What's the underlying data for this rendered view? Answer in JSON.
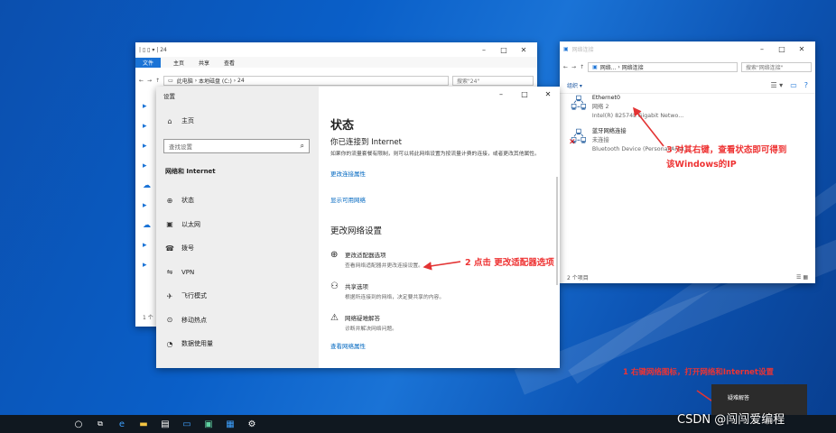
{
  "explorer": {
    "qat": "| ▯ ▯ ▾ | 24",
    "ribbon_tabs": [
      "文件",
      "主页",
      "共享",
      "查看"
    ],
    "address_path": [
      "此电脑",
      "本地磁盘 (C:)",
      "24"
    ],
    "search_placeholder": "搜索\"24\"",
    "status": "1 个"
  },
  "settings": {
    "title": "设置",
    "home": "主页",
    "search_placeholder": "查找设置",
    "section": "网络和 Internet",
    "nav": [
      {
        "icon": "status-icon",
        "glyph": "⊕",
        "label": "状态"
      },
      {
        "icon": "ethernet-icon",
        "glyph": "▣",
        "label": "以太网"
      },
      {
        "icon": "dialup-icon",
        "glyph": "☎",
        "label": "拨号"
      },
      {
        "icon": "vpn-icon",
        "glyph": "⇋",
        "label": "VPN"
      },
      {
        "icon": "airplane-icon",
        "glyph": "✈",
        "label": "飞行模式"
      },
      {
        "icon": "hotspot-icon",
        "glyph": "⊙",
        "label": "移动热点"
      },
      {
        "icon": "data-usage-icon",
        "glyph": "◔",
        "label": "数据使用量"
      }
    ],
    "main": {
      "heading": "状态",
      "connected": "你已连接到 Internet",
      "description": "如果你的流量套餐有限制，则可以将此网络设置为按流量计费的连接，或者更改其他属性。",
      "link_change_props": "更改连接属性",
      "link_show_networks": "显示可用网络",
      "sub_heading": "更改网络设置",
      "options": [
        {
          "icon": "adapter-icon",
          "glyph": "⊕",
          "title": "更改适配器选项",
          "desc": "查看网络适配器并更改连接设置。"
        },
        {
          "icon": "sharing-icon",
          "glyph": "⚇",
          "title": "共享选项",
          "desc": "根据所连接到的网络，决定要共享的内容。"
        },
        {
          "icon": "troubleshoot-icon",
          "glyph": "⚠",
          "title": "网络疑难解答",
          "desc": "诊断并解决网络问题。"
        }
      ],
      "link_view_props": "查看网络属性"
    }
  },
  "netconn": {
    "address_path": [
      "网络...",
      "网络连接"
    ],
    "search_placeholder": "搜索\"网络连接\"",
    "organize": "组织 ▾",
    "items": [
      {
        "name": "Ethernet0",
        "sub": "网络 2",
        "device": "Intel(R) 82574L Gigabit Netwo..."
      },
      {
        "name": "蓝牙网络连接",
        "sub": "未连接",
        "device": "Bluetooth Device (Personal Area ..."
      }
    ],
    "status": "2 个项目"
  },
  "annotations": {
    "step1": "1 右键网络图标，打开网络和Internet设置",
    "step2": "2 点击 更改适配器选项",
    "step3_line1": "3 对其右键，查看状态即可得到",
    "step3_line2": "该Windows的IP"
  },
  "context_menu": {
    "item": "疑难解答"
  },
  "watermark": "CSDN @闯闯爱编程",
  "colors": {
    "accent": "#0067c0",
    "annotation": "#e33333",
    "taskbar": "#101820"
  }
}
